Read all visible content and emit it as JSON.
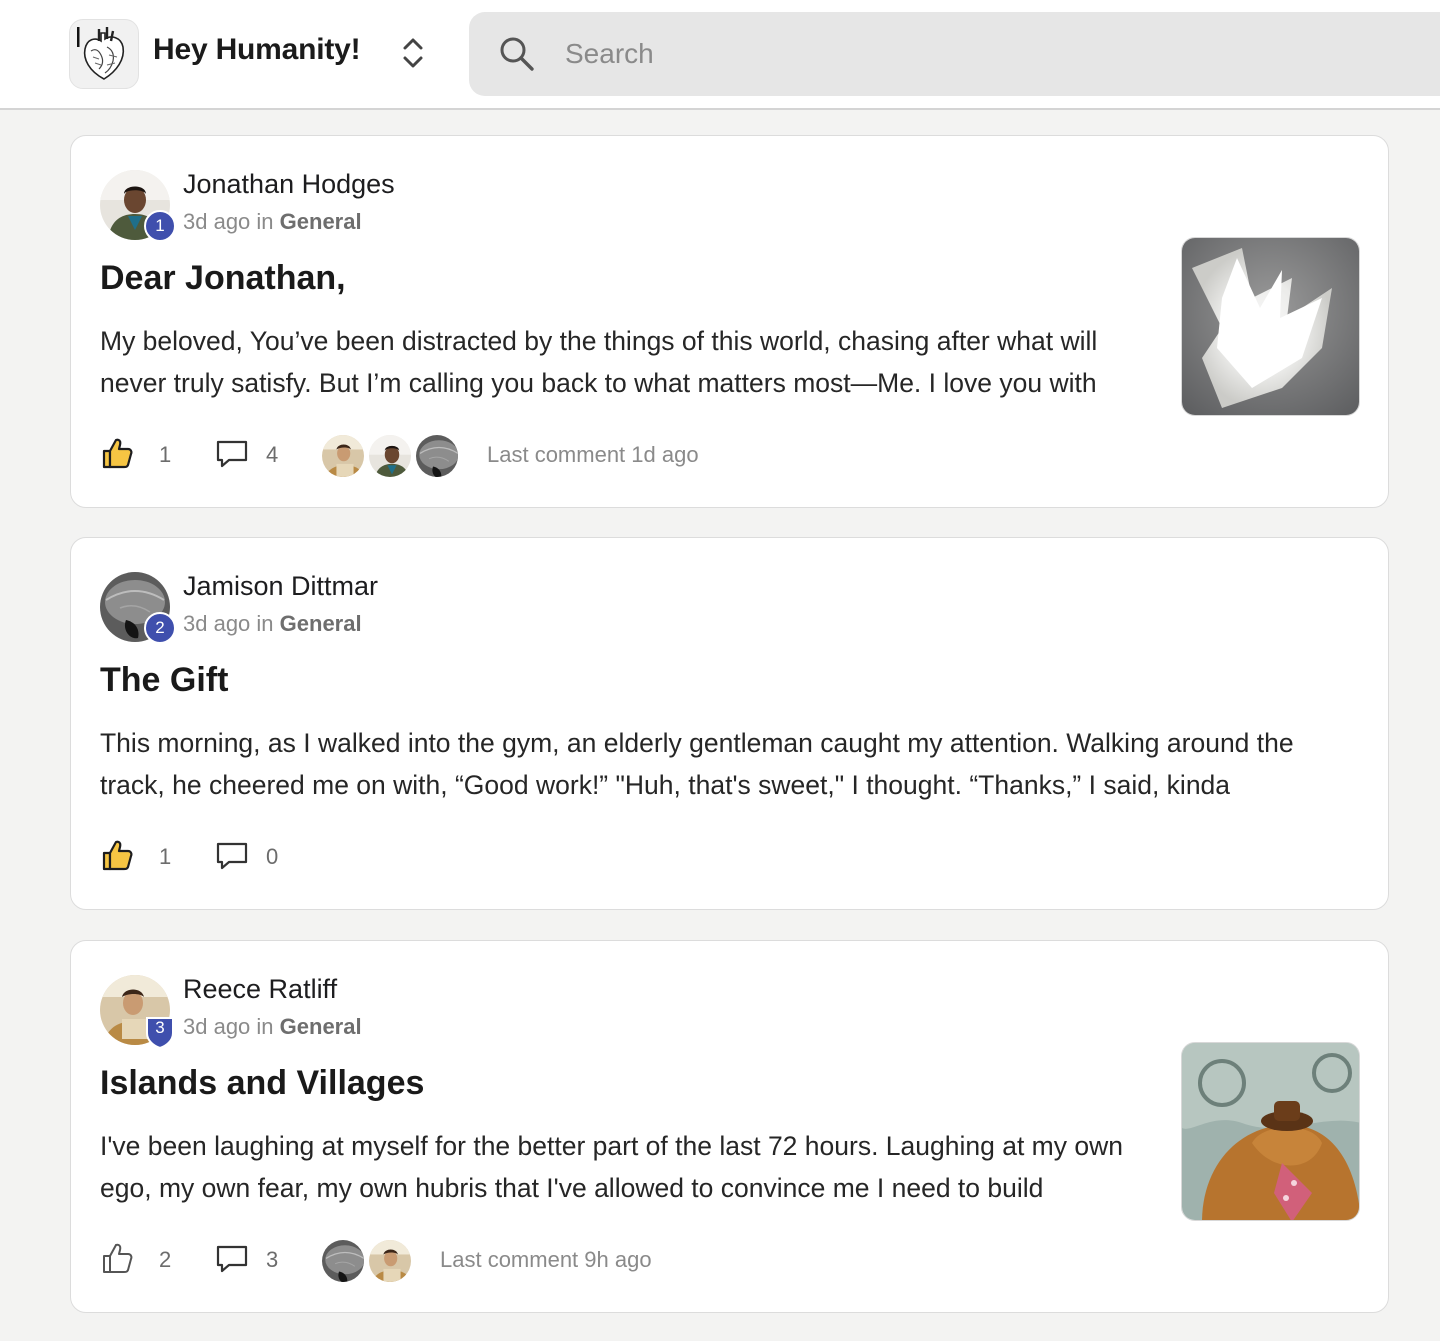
{
  "app": {
    "title": "Hey Humanity!",
    "logo_icon": "anatomical-heart-icon",
    "switcher_icon": "chevron-up-down-icon"
  },
  "search": {
    "placeholder": "Search",
    "value": "",
    "icon": "search-icon"
  },
  "colors": {
    "badge": "#3f4fad",
    "like_active": "#f6c543",
    "muted_text": "#8a8a8a",
    "card_border": "#dcdcdc"
  },
  "posts": [
    {
      "author": "Jonathan Hodges",
      "rank": "1",
      "time": "3d ago in",
      "category": "General",
      "title": "Dear Jonathan,",
      "excerpt": "My beloved, You’ve been distracted by the things of this world, chasing after what will never truly satisfy. But I’m calling you back to what matters most—Me. I love you with",
      "likes": "1",
      "liked": true,
      "comments": "4",
      "last_comment": "Last comment 1d ago",
      "thumbnail": "glowing-dove-image"
    },
    {
      "author": "Jamison Dittmar",
      "rank": "2",
      "time": "3d ago in",
      "category": "General",
      "title": "The Gift",
      "excerpt": "This morning, as I walked into the gym, an elderly gentleman caught my attention. Walking around the track, he cheered me on with, “Good work!” \"Huh, that's sweet,\" I thought. “Thanks,” I said, kinda",
      "likes": "1",
      "liked": true,
      "comments": "0"
    },
    {
      "author": "Reece Ratliff",
      "rank": "3",
      "time": "3d ago in",
      "category": "General",
      "title": "Islands and Villages",
      "excerpt": "I've been laughing at myself for the better part of the last 72 hours. Laughing at my own ego, my own fear, my own hubris that I've allowed to convince me I need to build",
      "likes": "2",
      "liked": false,
      "comments": "3",
      "last_comment": "Last comment 9h ago",
      "thumbnail": "fozzie-bear-image"
    }
  ]
}
